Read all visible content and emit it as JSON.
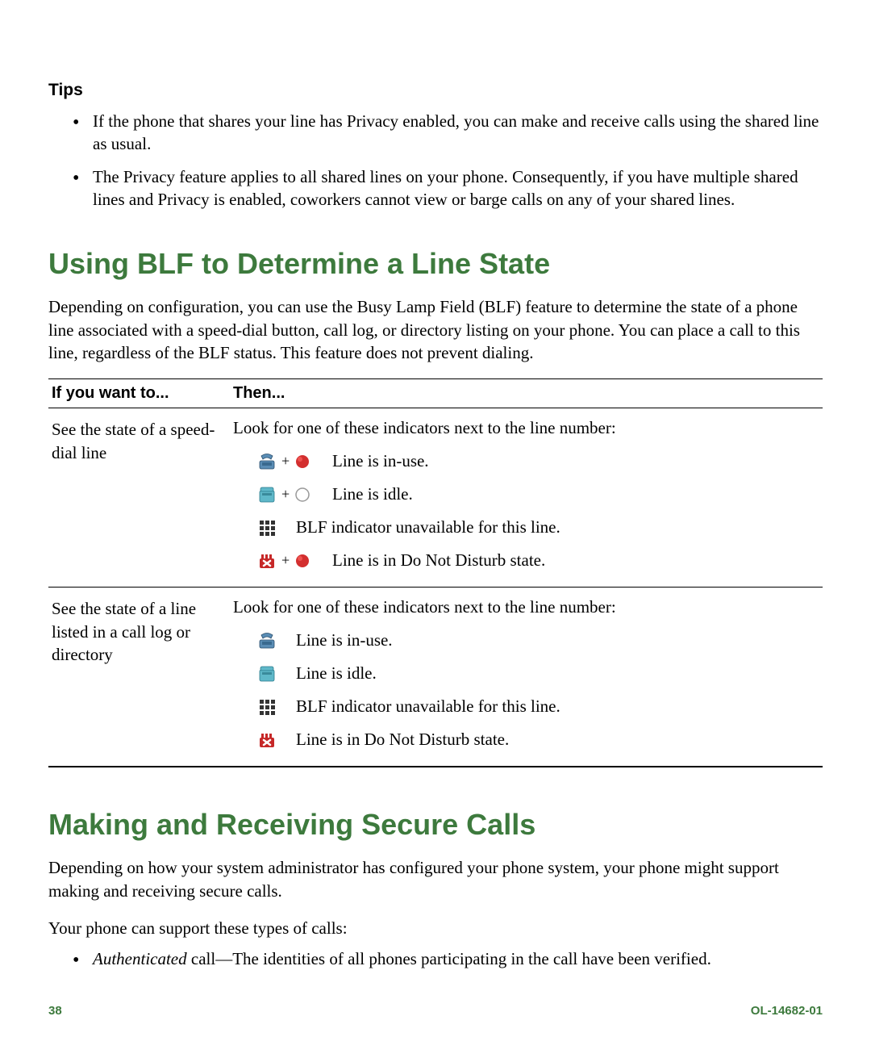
{
  "tips": {
    "heading": "Tips",
    "items": [
      "If the phone that shares your line has Privacy enabled, you can make and receive calls using the shared line as usual.",
      "The Privacy feature applies to all shared lines on your phone. Consequently, if you have multiple shared lines and Privacy is enabled, coworkers cannot view or barge calls on any of your shared lines."
    ]
  },
  "blf_section": {
    "heading": "Using BLF to Determine a Line State",
    "intro": "Depending on configuration, you can use the Busy Lamp Field (BLF) feature to determine the state of a phone line associated with a speed-dial button, call log, or directory listing on your phone. You can place a call to this line, regardless of the BLF status. This feature does not prevent dialing.",
    "table": {
      "col1_header": "If you want to...",
      "col2_header": "Then...",
      "rows": [
        {
          "want": "See the state of a speed-dial line",
          "intro": "Look for one of these indicators next to the line number:",
          "indicators": [
            {
              "text": "Line is in-use.",
              "show_plus": true,
              "dot": "red",
              "icon": "phone-offhook"
            },
            {
              "text": "Line is idle.",
              "show_plus": true,
              "dot": "empty",
              "icon": "phone-idle"
            },
            {
              "text": "BLF indicator unavailable for this line.",
              "show_plus": false,
              "dot": null,
              "icon": "grid"
            },
            {
              "text": "Line is in Do Not Disturb state.",
              "show_plus": true,
              "dot": "red",
              "icon": "dnd"
            }
          ]
        },
        {
          "want": "See the state of a line listed in a call log or directory",
          "intro": "Look for one of these indicators next to the line number:",
          "indicators": [
            {
              "text": "Line is in-use.",
              "show_plus": false,
              "dot": null,
              "icon": "phone-offhook"
            },
            {
              "text": "Line is idle.",
              "show_plus": false,
              "dot": null,
              "icon": "phone-idle"
            },
            {
              "text": "BLF indicator unavailable for this line.",
              "show_plus": false,
              "dot": null,
              "icon": "grid"
            },
            {
              "text": "Line is in Do Not Disturb state.",
              "show_plus": false,
              "dot": null,
              "icon": "dnd"
            }
          ]
        }
      ]
    }
  },
  "secure_section": {
    "heading": "Making and Receiving Secure Calls",
    "para1": "Depending on how your system administrator has configured your phone system, your phone might support making and receiving secure calls.",
    "para2": "Your phone can support these types of calls:",
    "bullet_italic": "Authenticated",
    "bullet_rest": " call—The identities of all phones participating in the call have been verified."
  },
  "footer": {
    "page": "38",
    "docid": "OL-14682-01"
  }
}
